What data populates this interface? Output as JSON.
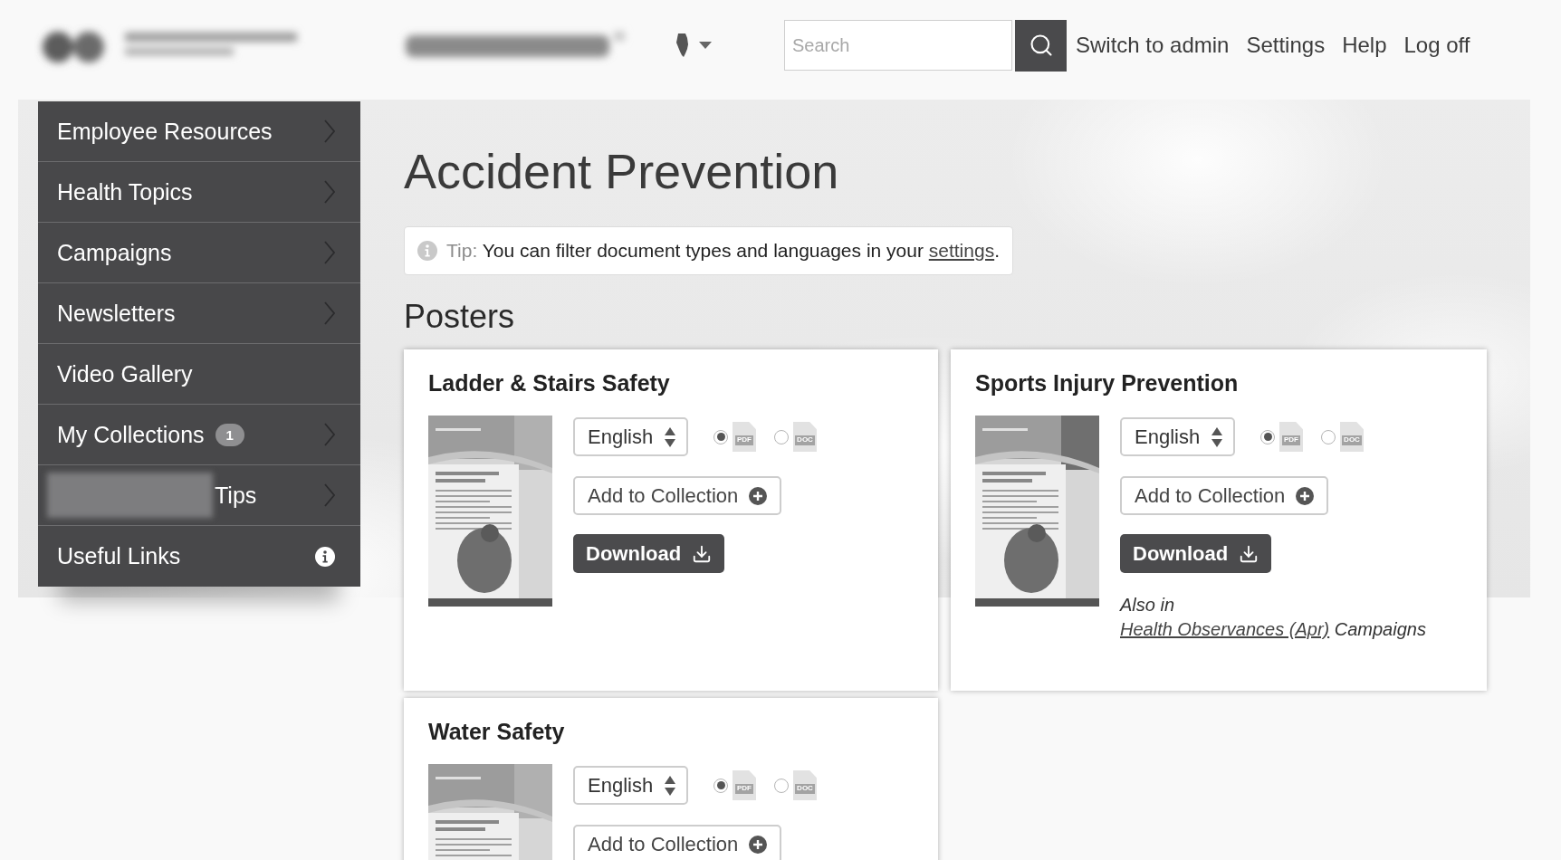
{
  "header": {
    "search": {
      "placeholder": "Search"
    },
    "links": [
      "Switch to admin",
      "Settings",
      "Help",
      "Log off"
    ]
  },
  "sidebar": {
    "items": [
      {
        "label": "Employee Resources",
        "kind": "menu"
      },
      {
        "label": "Health Topics",
        "kind": "menu"
      },
      {
        "label": "Campaigns",
        "kind": "menu"
      },
      {
        "label": "Newsletters",
        "kind": "menu"
      },
      {
        "label": "Video Gallery",
        "kind": "link"
      },
      {
        "label": "My Collections",
        "kind": "menu",
        "badge": "1"
      },
      {
        "label": "Tips",
        "kind": "menu",
        "blurred_prefix": true
      },
      {
        "label": "Useful Links",
        "kind": "info"
      }
    ]
  },
  "page": {
    "title": "Accident Prevention",
    "tip": {
      "label": "Tip:",
      "text": "You can filter document types and languages in your",
      "link": "settings",
      "end": "."
    },
    "section_title": "Posters"
  },
  "cards": [
    {
      "title": "Ladder & Stairs Safety",
      "language": "English",
      "formats": [
        {
          "label": "PDF",
          "selected": true
        },
        {
          "label": "DOC",
          "selected": false
        }
      ],
      "add_button": "Add to Collection",
      "download_button": "Download"
    },
    {
      "title": "Sports Injury Prevention",
      "language": "English",
      "formats": [
        {
          "label": "PDF",
          "selected": true
        },
        {
          "label": "DOC",
          "selected": false
        }
      ],
      "add_button": "Add to Collection",
      "download_button": "Download",
      "also_in": {
        "label": "Also in",
        "link": "Health Observances (Apr)",
        "suffix": "Campaigns"
      }
    },
    {
      "title": "Water Safety",
      "language": "English",
      "formats": [
        {
          "label": "PDF",
          "selected": true
        },
        {
          "label": "DOC",
          "selected": false
        }
      ],
      "add_button": "Add to Collection"
    }
  ]
}
